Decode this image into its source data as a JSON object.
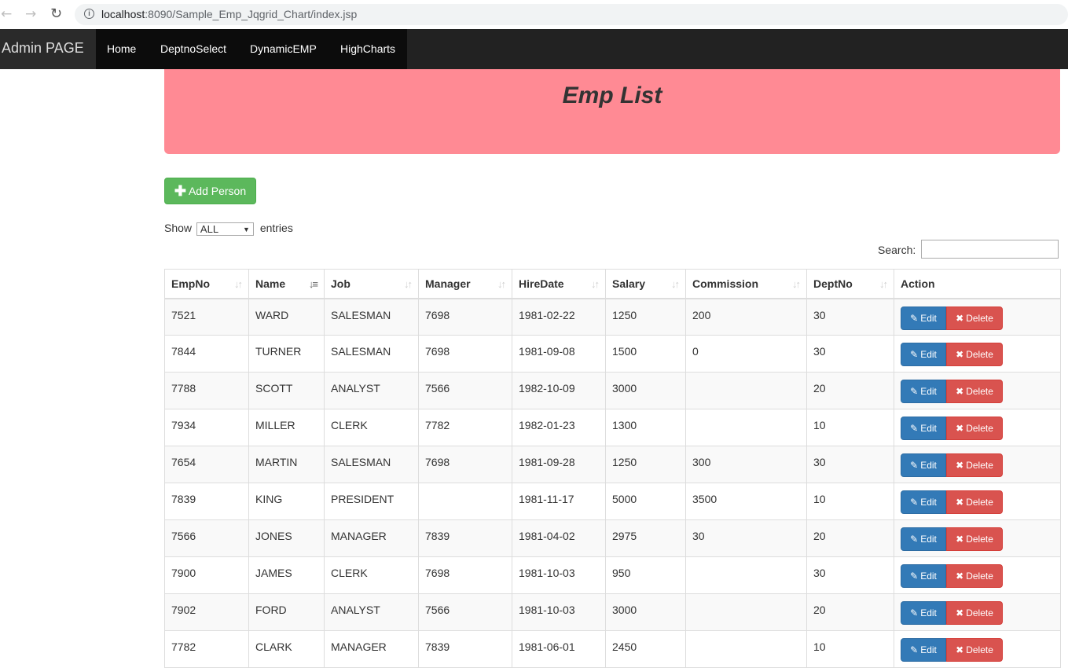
{
  "browser": {
    "url_host": "localhost",
    "url_path": ":8090/Sample_Emp_Jqgrid_Chart/index.jsp"
  },
  "navbar": {
    "brand": "Admin PAGE",
    "links": [
      "Home",
      "DeptnoSelect",
      "DynamicEMP",
      "HighCharts"
    ]
  },
  "header": {
    "title": "Emp List"
  },
  "toolbar": {
    "add_label": "Add Person"
  },
  "length_menu": {
    "show_label": "Show",
    "selected": "ALL",
    "entries_label": "entries"
  },
  "search": {
    "label": "Search:",
    "value": ""
  },
  "table": {
    "columns": [
      "EmpNo",
      "Name",
      "Job",
      "Manager",
      "HireDate",
      "Salary",
      "Commission",
      "DeptNo",
      "Action"
    ],
    "sorted_column": "Name",
    "rows": [
      [
        "7521",
        "WARD",
        "SALESMAN",
        "7698",
        "1981-02-22",
        "1250",
        "200",
        "30"
      ],
      [
        "7844",
        "TURNER",
        "SALESMAN",
        "7698",
        "1981-09-08",
        "1500",
        "0",
        "30"
      ],
      [
        "7788",
        "SCOTT",
        "ANALYST",
        "7566",
        "1982-10-09",
        "3000",
        "",
        "20"
      ],
      [
        "7934",
        "MILLER",
        "CLERK",
        "7782",
        "1982-01-23",
        "1300",
        "",
        "10"
      ],
      [
        "7654",
        "MARTIN",
        "SALESMAN",
        "7698",
        "1981-09-28",
        "1250",
        "300",
        "30"
      ],
      [
        "7839",
        "KING",
        "PRESIDENT",
        "",
        "1981-11-17",
        "5000",
        "3500",
        "10"
      ],
      [
        "7566",
        "JONES",
        "MANAGER",
        "7839",
        "1981-04-02",
        "2975",
        "30",
        "20"
      ],
      [
        "7900",
        "JAMES",
        "CLERK",
        "7698",
        "1981-10-03",
        "950",
        "",
        "30"
      ],
      [
        "7902",
        "FORD",
        "ANALYST",
        "7566",
        "1981-10-03",
        "3000",
        "",
        "20"
      ],
      [
        "7782",
        "CLARK",
        "MANAGER",
        "7839",
        "1981-06-01",
        "2450",
        "",
        "10"
      ]
    ],
    "edit_label": "Edit",
    "delete_label": "Delete"
  },
  "colors": {
    "navbar_bg": "#222222",
    "jumbotron_bg": "#ff8a94",
    "add_button": "#5cb85c",
    "edit_button": "#337ab7",
    "delete_button": "#d9534f"
  },
  "icons": {
    "back": "arrow-left-icon",
    "forward": "arrow-right-icon",
    "reload": "reload-icon",
    "info": "info-icon",
    "add": "plus-icon",
    "edit": "pencil-icon",
    "delete": "trash-icon",
    "sort": "sort-icon"
  }
}
